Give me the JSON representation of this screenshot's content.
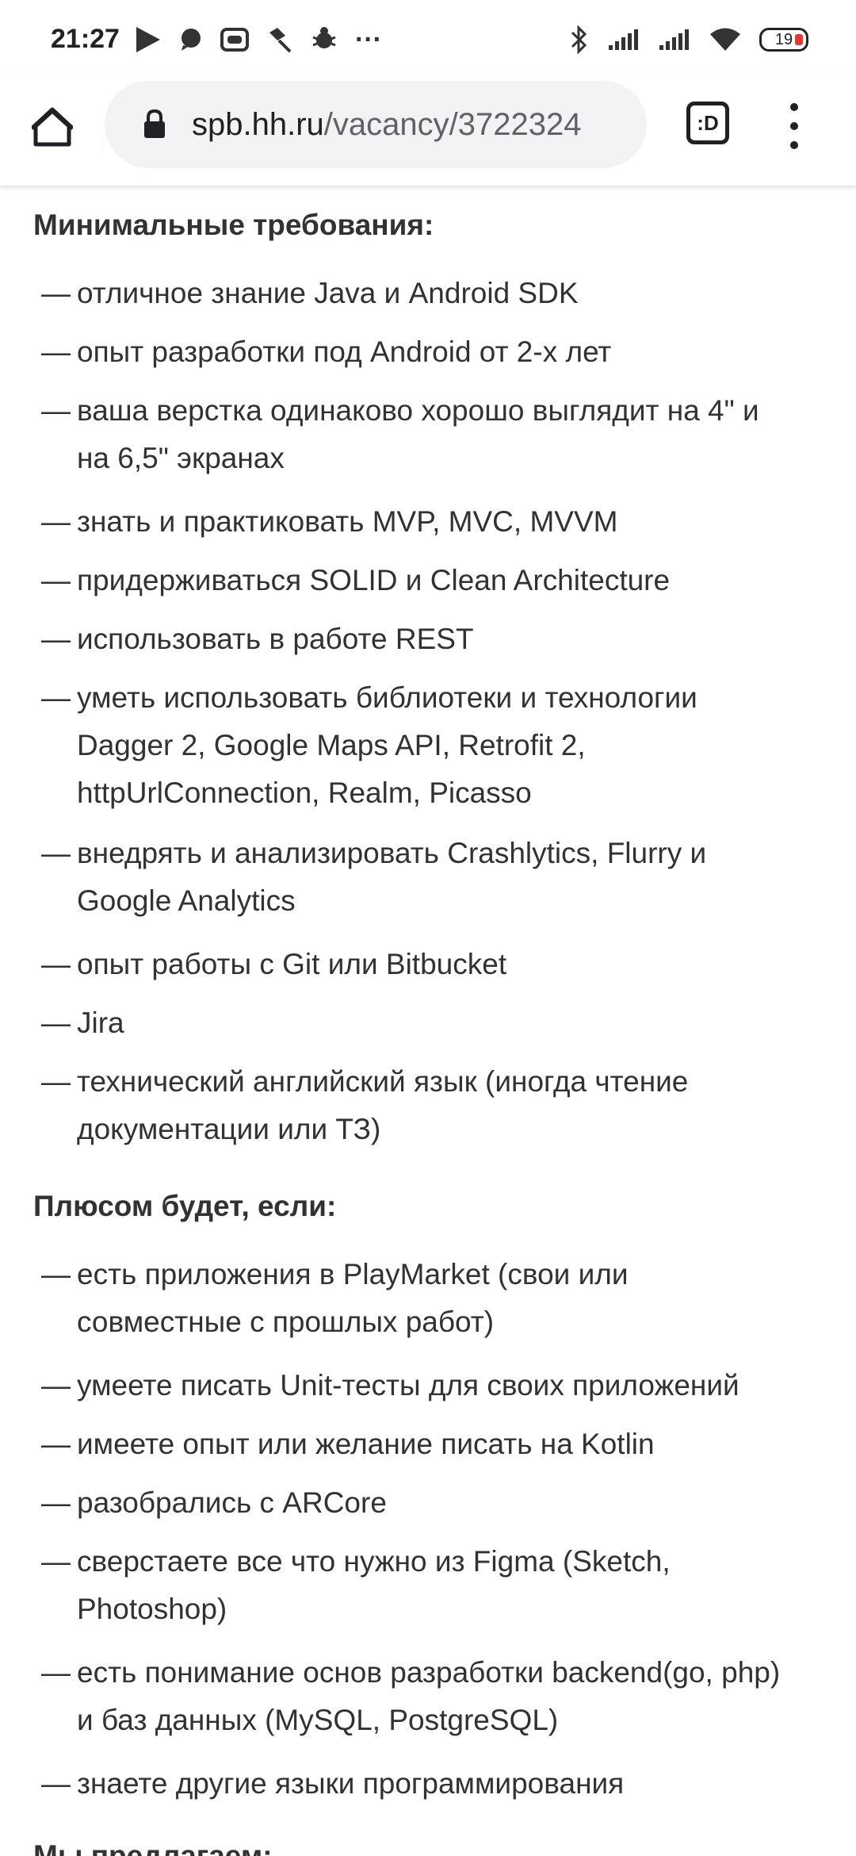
{
  "status_bar": {
    "time": "21:27",
    "more": "···",
    "battery": "19",
    "left_icons": [
      "play-icon",
      "message-icon",
      "ok-icon",
      "pen-icon",
      "bug-icon",
      "more-icon"
    ],
    "right_icons": [
      "bluetooth-icon",
      "signal-icon",
      "signal-icon",
      "wifi-icon",
      "battery-icon"
    ]
  },
  "toolbar": {
    "url_domain": "spb.hh.ru",
    "url_path": "/vacancy/3722324",
    "tabs_label": ":D"
  },
  "sections": [
    {
      "title": "Минимальные требования:",
      "items": [
        [
          "отличное знание Java и Android SDK"
        ],
        [
          "опыт разработки под Android от 2-х лет"
        ],
        [
          "ваша верстка одинаково хорошо выглядит на 4\" и",
          "на 6,5\" экранах"
        ],
        [
          "знать и практиковать MVP, MVC, MVVM"
        ],
        [
          "придерживаться SOLID и Clean Architecture"
        ],
        [
          "использовать в работе REST"
        ],
        [
          "уметь использовать библиотеки и технологии",
          "Dagger 2, Google Maps API, Retrofit 2,",
          "httpUrlConnection, Realm, Picasso"
        ],
        [
          "внедрять и анализировать Crashlytics, Flurry и",
          "Google Analytics"
        ],
        [
          "опыт работы с Git или Bitbucket"
        ],
        [
          "Jira"
        ],
        [
          "технический английский язык (иногда чтение",
          "документации или ТЗ)"
        ]
      ]
    },
    {
      "title": "Плюсом будет, если:",
      "items": [
        [
          "есть приложения в PlayMarket (свои или",
          "совместные с прошлых работ)"
        ],
        [
          "умеете писать Unit-тесты для своих приложений"
        ],
        [
          "имеете опыт или желание писать на Kotlin"
        ],
        [
          "разобрались с ARCore"
        ],
        [
          "сверстаете все что нужно из Figma (Sketch,",
          "Photoshop)"
        ],
        [
          "есть понимание основ разработки backend(go, php)",
          "и баз данных (MySQL, PostgreSQL)"
        ],
        [
          "знаете другие языки программирования"
        ]
      ]
    },
    {
      "title": "Мы предлагаем:",
      "items": []
    }
  ],
  "dash": "—"
}
